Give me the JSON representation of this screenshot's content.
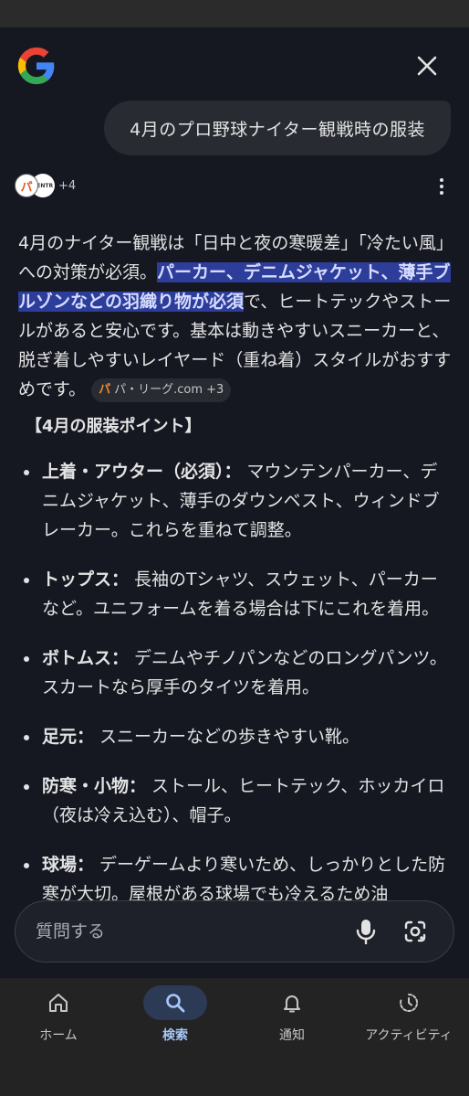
{
  "query": "4月のプロ野球ナイター観戦時の服装",
  "sources": {
    "icon1": "パ",
    "icon2": "CENTR",
    "more": "+4"
  },
  "answer": {
    "part1": "4月のナイター観戦は「日中と夜の寒暖差」「冷たい風」への対策が必須。",
    "highlight": "パーカー、デニムジャケット、薄手ブルゾンなどの羽織り物が必須",
    "part2": "で、ヒートテックやストールがあると安心です。基本は動きやすいスニーカーと、脱ぎ着しやすいレイヤード（重ね着）スタイルがおすすめです。",
    "citation_icon": "パ",
    "citation": "パ・リーグ.com +3"
  },
  "section_title": "【4月の服装ポイント】",
  "bullets": [
    {
      "label": "上着・アウター（必須）：",
      "text": " マウンテンパーカー、デニムジャケット、薄手のダウンベスト、ウィンドブレーカー。これらを重ねて調整。"
    },
    {
      "label": "トップス：",
      "text": " 長袖のTシャツ、スウェット、パーカーなど。ユニフォームを着る場合は下にこれを着用。"
    },
    {
      "label": "ボトムス：",
      "text": " デニムやチノパンなどのロングパンツ。スカートなら厚手のタイツを着用。"
    },
    {
      "label": "足元：",
      "text": " スニーカーなどの歩きやすい靴。"
    },
    {
      "label": "防寒・小物：",
      "text": " ストール、ヒートテック、ホッカイロ（夜は冷え込む）、帽子。"
    },
    {
      "label": "球場：",
      "text": " デーゲームより寒いため、しっかりとした防寒が大切。屋根がある球場でも冷えるため油"
    }
  ],
  "input": {
    "placeholder": "質問する"
  },
  "nav": {
    "home": "ホーム",
    "search": "検索",
    "notify": "通知",
    "activity": "アクティビティ"
  },
  "colors": {
    "background": "#151821",
    "highlight": "#2d3d9a",
    "active_nav": "#a8c7fa"
  }
}
